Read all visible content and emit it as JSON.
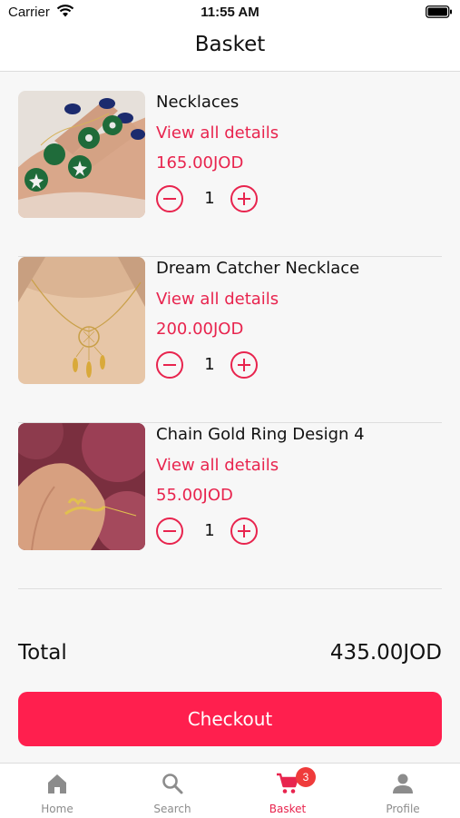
{
  "status_bar": {
    "carrier": "Carrier",
    "time": "11:55 AM"
  },
  "header": {
    "title": "Basket"
  },
  "basket": {
    "items": [
      {
        "name": "Necklaces",
        "details_link": "View all details",
        "price": "165.00JOD",
        "quantity": "1"
      },
      {
        "name": "Dream Catcher Necklace",
        "details_link": "View all details",
        "price": "200.00JOD",
        "quantity": "1"
      },
      {
        "name": "Chain Gold Ring Design 4",
        "details_link": "View all details",
        "price": "55.00JOD",
        "quantity": "1"
      }
    ],
    "total_label": "Total",
    "total_value": "435.00JOD"
  },
  "checkout": {
    "label": "Checkout"
  },
  "tab_bar": {
    "tabs": [
      {
        "label": "Home",
        "icon": "home-icon"
      },
      {
        "label": "Search",
        "icon": "search-icon"
      },
      {
        "label": "Basket",
        "icon": "cart-icon",
        "badge": "3"
      },
      {
        "label": "Profile",
        "icon": "person-icon"
      }
    ],
    "active": "Basket"
  },
  "colors": {
    "accent": "#e8244e",
    "checkout": "#ff1f4e",
    "badge": "#ef3b3b",
    "inactive_tab": "#8c8c8c"
  }
}
